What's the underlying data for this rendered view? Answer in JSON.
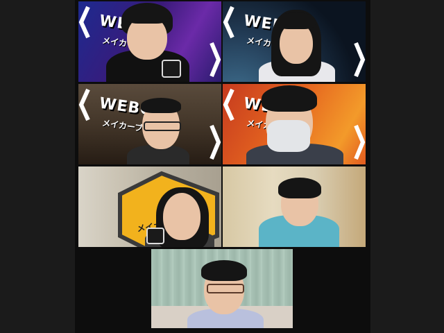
{
  "participants": [
    {
      "brand": "WEBOT",
      "brand_sub": "メイカーブル"
    },
    {
      "brand": "WEBOT",
      "brand_sub": "メイカーブル"
    },
    {
      "brand": "WEBOT",
      "brand_sub": "メイカーブル"
    },
    {
      "brand": "WEBOT",
      "brand_sub": "メイカーブル"
    },
    {
      "brand": "",
      "brand_sub": "メイカーブル"
    },
    {
      "brand": "",
      "brand_sub": ""
    },
    {
      "brand": "",
      "brand_sub": ""
    }
  ]
}
